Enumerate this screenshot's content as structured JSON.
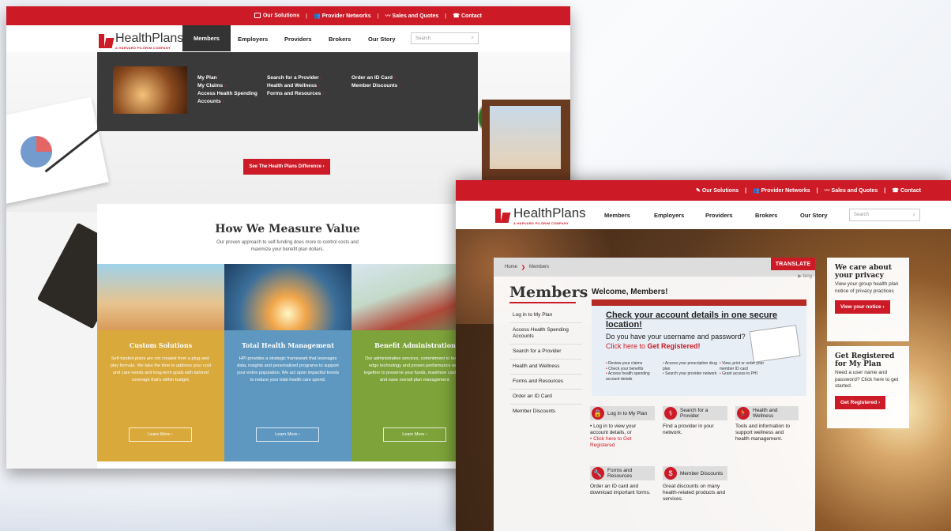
{
  "screenA": {
    "topbar": {
      "solutions": "Our Solutions",
      "networks": "Provider Networks",
      "sales": "Sales and Quotes",
      "contact": "Contact"
    },
    "logo": {
      "name": "HealthPlans",
      "tagline": "A HARVARD PILGRIM COMPANY"
    },
    "nav": {
      "members": "Members",
      "employers": "Employers",
      "providers": "Providers",
      "brokers": "Brokers",
      "story": "Our Story",
      "search_placeholder": "Search"
    },
    "dropdown": {
      "col1": [
        "My Plan",
        "My Claims",
        "Access Health Spending Accounts"
      ],
      "col2": [
        "Search for a Provider",
        "Health and Wellness",
        "Forms and Resources"
      ],
      "col3": [
        "Order an ID Card",
        "Member Discounts"
      ]
    },
    "difference_button": "See The Health Plans Difference  ›",
    "value": {
      "title": "How We Measure Value",
      "subtitle": "Our proven approach to self-funding does more to control costs and maximize your benefit plan dollars.",
      "tiles": [
        {
          "title": "Custom Solutions",
          "text": "Self-funded plans are not created from a plug-and-play formula. We take the time to address your cost and care needs and long-term goals with tailored coverage that's within budget.",
          "button": "Learn More  ›"
        },
        {
          "title": "Total Health Management",
          "text": "HPI provides a strategic framework that leverages data, insights and personalized programs to support your entire population. We act upon impactful trends to reduce your total health care spend.",
          "button": "Learn More  ›"
        },
        {
          "title": "Benefit Administration",
          "text": "Our administrative services, commitment to leading edge technology and proven performance work together to preserve your funds, maximize cash flow and ease overall plan management.",
          "button": "Learn More  ›"
        }
      ]
    }
  },
  "screenB": {
    "topbar": {
      "solutions": "Our Solutions",
      "networks": "Provider Networks",
      "sales": "Sales and Quotes",
      "contact": "Contact"
    },
    "logo": {
      "name": "HealthPlans",
      "tagline": "A HARVARD PILGRIM COMPANY"
    },
    "nav": {
      "members": "Members",
      "employers": "Employers",
      "providers": "Providers",
      "brokers": "Brokers",
      "story": "Our Story",
      "search_placeholder": "Search"
    },
    "breadcrumb": {
      "home": "Home",
      "current": "Members"
    },
    "translate": "TRANSLATE",
    "bing": "bing",
    "title": "Members",
    "sidebar": [
      "Log in to My Plan",
      "Access Health Spending Accounts",
      "Search for a Provider",
      "Health and Wellness",
      "Forms and Resources",
      "Order an ID Card",
      "Member Discounts"
    ],
    "welcome": "Welcome, Members!",
    "banner": {
      "headline": "Check your account details in one secure location!",
      "question": "Do you have your username and password?",
      "cta_prefix": "Click here to ",
      "cta_bold": "Get Registered!",
      "col1": [
        "Review your claims",
        "Check your benefits",
        "Access health spending account details"
      ],
      "col2": [
        "Access your prescription drug plan",
        "Search your provider network"
      ],
      "col3": [
        "View, print or order your member ID card",
        "Grant access to PHI"
      ]
    },
    "cards": [
      {
        "title": "Log in to My Plan",
        "line1": "Log in to view your account details, or",
        "line2": "Click here to Get Registered"
      },
      {
        "title": "Search for a Provider",
        "text": "Find a provider in your network."
      },
      {
        "title": "Health and Wellness",
        "text": "Tools and information to support wellness and health management."
      },
      {
        "title": "Forms and Resources",
        "text": "Order an ID card and download important forms."
      },
      {
        "title": "Member Discounts",
        "text": "Great discounts on many health-related products and services."
      }
    ],
    "privacy": {
      "title": "We care about your privacy",
      "text": "View your group health plan notice of privacy practices",
      "button": "View your notice  ›"
    },
    "register": {
      "title": "Get Registered for My Plan",
      "text": "Need a user name and password? Click here to get started.",
      "button": "Get Registered  ›"
    }
  }
}
